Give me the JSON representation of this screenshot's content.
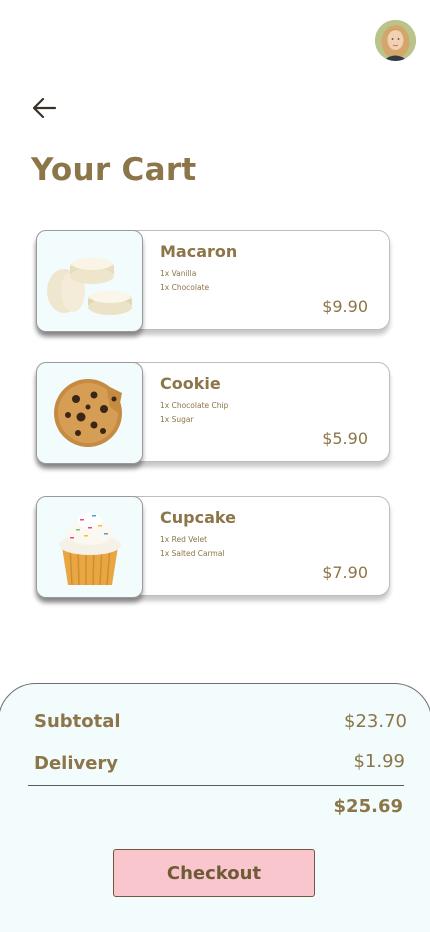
{
  "header": {
    "title": "Your Cart",
    "back_icon": "arrow-left-icon",
    "avatar_icon": "user-avatar"
  },
  "cart": {
    "items": [
      {
        "name": "Macaron",
        "options": [
          "1x Vanilla",
          "1x Chocolate"
        ],
        "price": "$9.90",
        "image": "macaron-image"
      },
      {
        "name": "Cookie",
        "options": [
          "1x Chocolate Chip",
          "1x Sugar"
        ],
        "price": "$5.90",
        "image": "cookie-image"
      },
      {
        "name": "Cupcake",
        "options": [
          "1x Red Velet",
          "1x Salted Carmal"
        ],
        "price": "$7.90",
        "image": "cupcake-image"
      }
    ]
  },
  "summary": {
    "subtotal_label": "Subtotal",
    "subtotal_value": "$23.70",
    "delivery_label": "Delivery",
    "delivery_value": "$1.99",
    "total_value": "$25.69",
    "checkout_label": "Checkout"
  },
  "colors": {
    "brand_text": "#8c7548",
    "panel_bg": "#f2fcfd",
    "checkout_bg": "#f9c6ce"
  }
}
